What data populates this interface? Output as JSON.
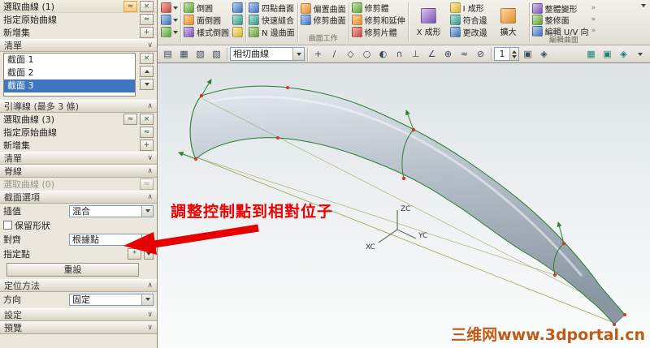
{
  "dialog": {
    "title": "選取曲線 (1)",
    "specify_origin": "指定原始曲線",
    "add_new_set": "新增集",
    "list_label": "清單",
    "items": [
      "截面 1",
      "截面 2",
      "截面 3"
    ],
    "guide_header": "引導線 (最多 3 條)",
    "select_curve3": "選取曲線 (3)",
    "specify_origin2": "指定原始曲線",
    "add_new_set2": "新增集",
    "list_label2": "清單",
    "spine_header": "脊線",
    "select_curve0": "選取曲線 (0)",
    "section_options": "截面選項",
    "interp_label": "插值",
    "interp_value": "混合",
    "keep_shape": "保留形狀",
    "align_label": "對齊",
    "align_value": "根據點",
    "point_label": "指定點",
    "reset": "重設",
    "positioning": "定位方法",
    "direction_label": "方向",
    "direction_value": "固定",
    "settings": "設定",
    "preview": "預覽"
  },
  "ribbon": {
    "col1": [
      "倒圓",
      "面倒圓",
      "樣式倒圓"
    ],
    "col2": [
      "四點曲面",
      "快速縫合",
      "N 邊曲面"
    ],
    "surface_group": {
      "label": "曲面工作",
      "items": [
        "偏置曲面",
        "修剪曲面"
      ]
    },
    "col3": [
      "修剪體",
      "修剪和延伸",
      "修剪片體"
    ],
    "xform": "X 成形",
    "col4": [
      "I 成形",
      "符合邊",
      "更改邊"
    ],
    "enlarge": "擴大",
    "edit_group": {
      "label": "編輯曲面",
      "items": [
        "整體變形",
        "整修面",
        "編輯 U/V 向"
      ]
    }
  },
  "selection_bar": {
    "curve_rule": "相切曲線",
    "count": "1"
  },
  "viewport": {
    "annotation": "調整控制點到相對位子",
    "watermark": "三维网www.3dportal.cn",
    "axes": {
      "z": "ZC",
      "x": "XC",
      "y": "YC"
    }
  },
  "icons": {
    "close": "×",
    "chevron_up": "∧",
    "chevron_down": "∨",
    "more": "»",
    "up_arrow": "▲",
    "down_arrow": "▼",
    "add": "+",
    "curve": "≈",
    "point": "*",
    "sb": {
      "v1": "▤",
      "v2": "▦",
      "v3": "▧",
      "v4": "▨",
      "s1": "+",
      "s2": "/",
      "s3": "◇",
      "s4": "○",
      "s5": "◐",
      "s6": "∩",
      "s7": "⊥",
      "s8": "∠",
      "s9": "⊕",
      "s10": "≈",
      "s11": "⊘",
      "p1": "▣",
      "p2": "◈"
    }
  }
}
